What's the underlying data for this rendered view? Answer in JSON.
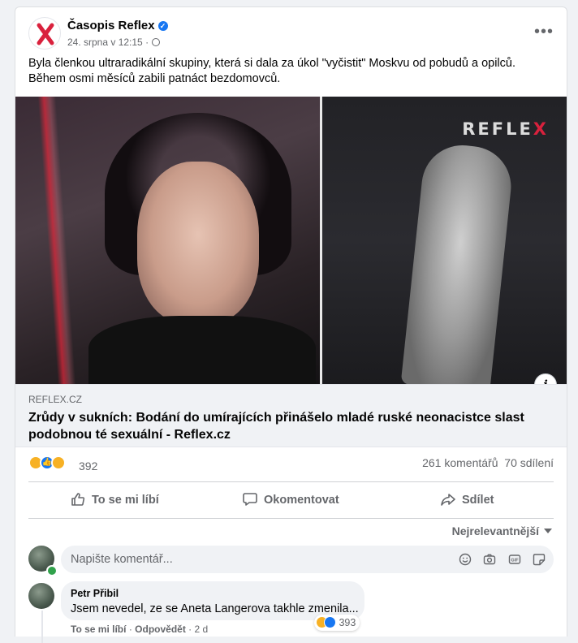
{
  "post": {
    "page_name": "Časopis Reflex",
    "date": "24. srpna v 12:15",
    "separator": "·",
    "text_line1": "Byla členkou ultraradikální skupiny, která si dala za úkol \"vyčistit\" Moskvu od pobudů a opilců.",
    "text_line2": "Během osmi měsíců zabili patnáct bezdomovců.",
    "image_brand": "REFLEX",
    "image_brand_main": "REFLE",
    "image_brand_x": "X",
    "info_label": "i"
  },
  "link": {
    "domain": "REFLEX.CZ",
    "headline": "Zrůdy v sukních: Bodání do umírajících přinášelo mladé ruské neonacistce slast podobnou té sexuální - Reflex.cz"
  },
  "stats": {
    "reaction_count": "392",
    "reactions": [
      "angry-icon",
      "like-icon",
      "sad-icon"
    ],
    "comments": "261 komentářů",
    "shares": "70 sdílení"
  },
  "actions": {
    "like": "To se mi líbí",
    "comment": "Okomentovat",
    "share": "Sdílet"
  },
  "sort": {
    "label": "Nejrelevantnější"
  },
  "comment_input": {
    "placeholder": "Napište komentář..."
  },
  "comments": [
    {
      "author": "Petr Přibil",
      "text": "Jsem nevedel, ze se Aneta Langerova takhle zmenila...",
      "reaction_count": "393",
      "like_label": "To se mi líbí",
      "dot": "·",
      "reply_label": "Odpovědět",
      "time": "2 d"
    }
  ],
  "colors": {
    "brand_blue": "#1877f2",
    "reflex_red": "#d9213d",
    "muted_text": "#65676b"
  }
}
